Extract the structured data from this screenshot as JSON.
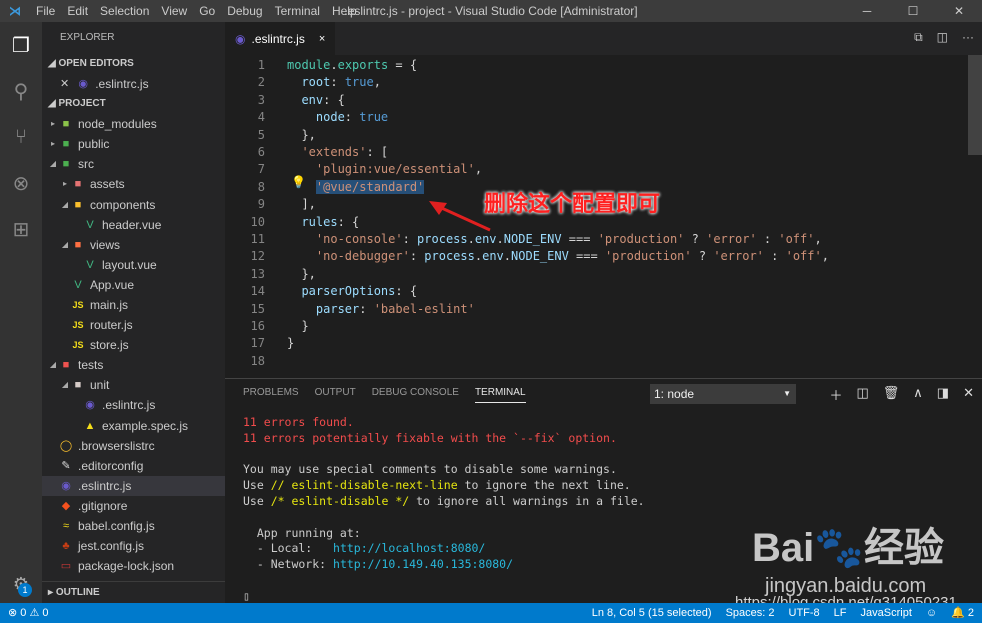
{
  "titlebar": {
    "menu": [
      "File",
      "Edit",
      "Selection",
      "View",
      "Go",
      "Debug",
      "Terminal",
      "Help"
    ],
    "title": ".eslintrc.js - project - Visual Studio Code [Administrator]"
  },
  "activity": {
    "icons": [
      "files-icon",
      "search-icon",
      "source-control-icon",
      "debug-icon",
      "extensions-icon"
    ],
    "badge": "1"
  },
  "sidebar": {
    "title": "EXPLORER",
    "open_editors": "OPEN EDITORS",
    "open_file": ".eslintrc.js",
    "project": "PROJECT",
    "outline": "OUTLINE",
    "tree": [
      {
        "label": "node_modules",
        "depth": 1,
        "tw": "▸",
        "icon": "■",
        "color": "#8bc34a"
      },
      {
        "label": "public",
        "depth": 1,
        "tw": "▸",
        "icon": "■",
        "color": "#4caf50"
      },
      {
        "label": "src",
        "depth": 1,
        "tw": "◢",
        "icon": "■",
        "color": "#4caf50"
      },
      {
        "label": "assets",
        "depth": 2,
        "tw": "▸",
        "icon": "■",
        "color": "#e57373"
      },
      {
        "label": "components",
        "depth": 2,
        "tw": "◢",
        "icon": "■",
        "color": "#fbc02d"
      },
      {
        "label": "header.vue",
        "depth": 3,
        "tw": "",
        "icon": "V",
        "color": "#41b883"
      },
      {
        "label": "views",
        "depth": 2,
        "tw": "◢",
        "icon": "■",
        "color": "#ff7043"
      },
      {
        "label": "layout.vue",
        "depth": 3,
        "tw": "",
        "icon": "V",
        "color": "#41b883"
      },
      {
        "label": "App.vue",
        "depth": 2,
        "tw": "",
        "icon": "V",
        "color": "#41b883"
      },
      {
        "label": "main.js",
        "depth": 2,
        "tw": "",
        "icon": "JS",
        "color": "#f5de19"
      },
      {
        "label": "router.js",
        "depth": 2,
        "tw": "",
        "icon": "JS",
        "color": "#f5de19"
      },
      {
        "label": "store.js",
        "depth": 2,
        "tw": "",
        "icon": "JS",
        "color": "#f5de19"
      },
      {
        "label": "tests",
        "depth": 1,
        "tw": "◢",
        "icon": "■",
        "color": "#ef5350"
      },
      {
        "label": "unit",
        "depth": 2,
        "tw": "◢",
        "icon": "■",
        "color": "#d7ccc8"
      },
      {
        "label": ".eslintrc.js",
        "depth": 3,
        "tw": "",
        "icon": "◉",
        "color": "#6a5acd"
      },
      {
        "label": "example.spec.js",
        "depth": 3,
        "tw": "",
        "icon": "▲",
        "color": "#f5de19"
      },
      {
        "label": ".browserslistrc",
        "depth": 1,
        "tw": "",
        "icon": "◯",
        "color": "#fbc02d"
      },
      {
        "label": ".editorconfig",
        "depth": 1,
        "tw": "",
        "icon": "✎",
        "color": "#ddd"
      },
      {
        "label": ".eslintrc.js",
        "depth": 1,
        "tw": "",
        "icon": "◉",
        "color": "#6a5acd",
        "selected": true
      },
      {
        "label": ".gitignore",
        "depth": 1,
        "tw": "",
        "icon": "◆",
        "color": "#f4511e"
      },
      {
        "label": "babel.config.js",
        "depth": 1,
        "tw": "",
        "icon": "≈",
        "color": "#f5de19"
      },
      {
        "label": "jest.config.js",
        "depth": 1,
        "tw": "",
        "icon": "♣",
        "color": "#c63d14"
      },
      {
        "label": "package-lock.json",
        "depth": 1,
        "tw": "",
        "icon": "▭",
        "color": "#cb3837"
      }
    ]
  },
  "tab": {
    "label": ".eslintrc.js",
    "close": "×"
  },
  "code": [
    [
      [
        "module",
        "m"
      ],
      [
        ".",
        "p"
      ],
      [
        "exports",
        "m"
      ],
      [
        " = {",
        "p"
      ]
    ],
    [
      [
        "  root",
        "k"
      ],
      [
        ": ",
        "p"
      ],
      [
        "true",
        "b"
      ],
      [
        ",",
        "p"
      ]
    ],
    [
      [
        "  env",
        "k"
      ],
      [
        ": {",
        "p"
      ]
    ],
    [
      [
        "    node",
        "k"
      ],
      [
        ": ",
        "p"
      ],
      [
        "true",
        "b"
      ]
    ],
    [
      [
        "  },",
        "p"
      ]
    ],
    [
      [
        "  'extends'",
        "s"
      ],
      [
        ": [",
        "p"
      ]
    ],
    [
      [
        "    'plugin:vue/essential'",
        "s"
      ],
      [
        ",",
        "p"
      ]
    ],
    [
      [
        "    ",
        "p"
      ],
      [
        "'@vue/standard'",
        "s selhl"
      ]
    ],
    [
      [
        "  ],",
        "p"
      ]
    ],
    [
      [
        "  rules",
        "k"
      ],
      [
        ": {",
        "p"
      ]
    ],
    [
      [
        "    'no-console'",
        "s"
      ],
      [
        ": ",
        "p"
      ],
      [
        "process",
        "k"
      ],
      [
        ".",
        "p"
      ],
      [
        "env",
        "k"
      ],
      [
        ".",
        "p"
      ],
      [
        "NODE_ENV",
        "k"
      ],
      [
        " === ",
        "p"
      ],
      [
        "'production'",
        "s"
      ],
      [
        " ? ",
        "p"
      ],
      [
        "'error'",
        "s"
      ],
      [
        " : ",
        "p"
      ],
      [
        "'off'",
        "s"
      ],
      [
        ",",
        "p"
      ]
    ],
    [
      [
        "    'no-debugger'",
        "s"
      ],
      [
        ": ",
        "p"
      ],
      [
        "process",
        "k"
      ],
      [
        ".",
        "p"
      ],
      [
        "env",
        "k"
      ],
      [
        ".",
        "p"
      ],
      [
        "NODE_ENV",
        "k"
      ],
      [
        " === ",
        "p"
      ],
      [
        "'production'",
        "s"
      ],
      [
        " ? ",
        "p"
      ],
      [
        "'error'",
        "s"
      ],
      [
        " : ",
        "p"
      ],
      [
        "'off'",
        "s"
      ],
      [
        ",",
        "p"
      ]
    ],
    [
      [
        "  },",
        "p"
      ]
    ],
    [
      [
        "  parserOptions",
        "k"
      ],
      [
        ": {",
        "p"
      ]
    ],
    [
      [
        "    parser",
        "k"
      ],
      [
        ": ",
        "p"
      ],
      [
        "'babel-eslint'",
        "s"
      ]
    ],
    [
      [
        "  }",
        "p"
      ]
    ],
    [
      [
        "}",
        "p"
      ]
    ],
    [
      [
        "",
        "p"
      ]
    ]
  ],
  "annotation": "删除这个配置即可",
  "panel": {
    "tabs": [
      "PROBLEMS",
      "OUTPUT",
      "DEBUG CONSOLE",
      "TERMINAL"
    ],
    "active": "TERMINAL",
    "terminal_select": "1: node",
    "terminal": [
      [
        [
          "11 errors found.",
          "r"
        ]
      ],
      [
        [
          "11 errors potentially fixable with the `--fix` option.",
          "r"
        ]
      ],
      [
        [
          "",
          "w"
        ]
      ],
      [
        [
          "You may use special comments to disable some warnings.",
          "w"
        ]
      ],
      [
        [
          "Use ",
          "w"
        ],
        [
          "// eslint-disable-next-line",
          "y"
        ],
        [
          " to ignore the next line.",
          "w"
        ]
      ],
      [
        [
          "Use ",
          "w"
        ],
        [
          "/* eslint-disable */",
          "y"
        ],
        [
          " to ignore all warnings in a file.",
          "w"
        ]
      ],
      [
        [
          "",
          "w"
        ]
      ],
      [
        [
          "  App running at:",
          "w"
        ]
      ],
      [
        [
          "  - Local:   ",
          "w"
        ],
        [
          "http://localhost:8080/",
          "u"
        ]
      ],
      [
        [
          "  - Network: ",
          "w"
        ],
        [
          "http://10.149.40.135:8080/",
          "u"
        ]
      ],
      [
        [
          "",
          "w"
        ]
      ],
      [
        [
          "▯",
          "w"
        ]
      ]
    ]
  },
  "status": {
    "errors": "0",
    "warnings": "0",
    "position": "Ln 8, Col 5 (15 selected)",
    "spaces": "Spaces: 2",
    "encoding": "UTF-8",
    "eol": "LF",
    "language": "JavaScript",
    "notifications": "2"
  },
  "watermark": {
    "brand": "Bai du 经验",
    "site": "jingyan.baidu.com",
    "url": "https://blog.csdn.net/q314050231"
  }
}
